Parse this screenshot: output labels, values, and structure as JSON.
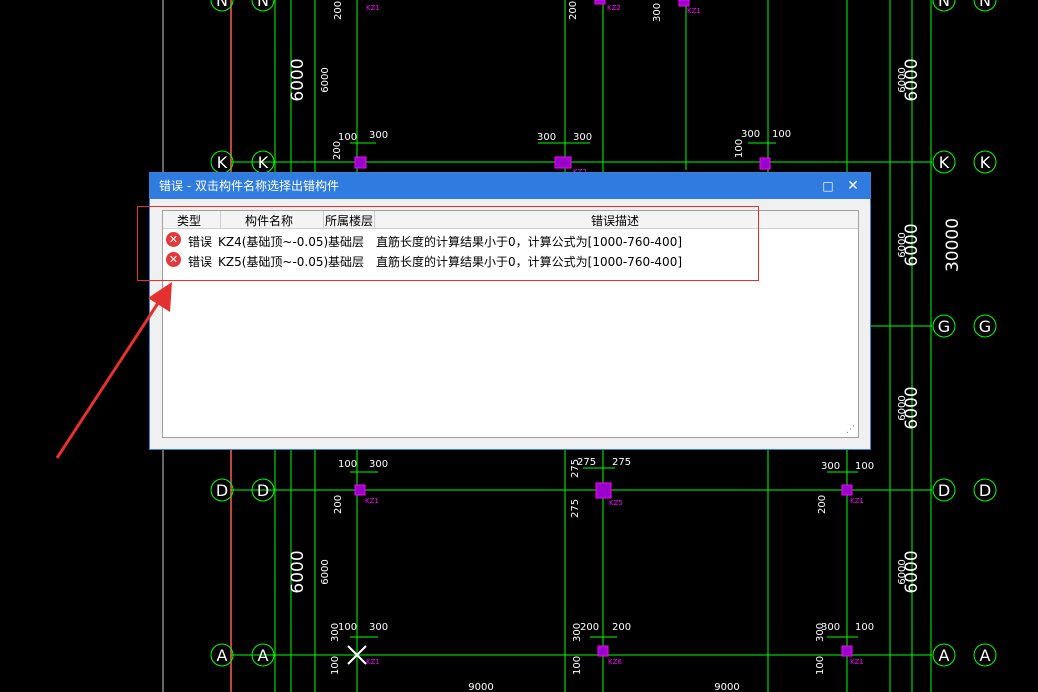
{
  "dialog": {
    "title": "错误 - 双击构件名称选择出错构件",
    "maximize_glyph": "□",
    "close_glyph": "✕",
    "columns": {
      "type": "类型",
      "name": "构件名称",
      "floor": "所属楼层",
      "description": "错误描述"
    },
    "rows": [
      {
        "type": "错误",
        "name": "KZ4(基础顶~-0.05)",
        "floor": "基础层",
        "description": "直筋长度的计算结果小于0，计算公式为[1000-760-400]"
      },
      {
        "type": "错误",
        "name": "KZ5(基础顶~-0.05)",
        "floor": "基础层",
        "description": "直筋长度的计算结果小于0，计算公式为[1000-760-400]"
      }
    ],
    "error_icon_glyph": "✕"
  },
  "drawing": {
    "axis_labels": [
      "N",
      "K",
      "G",
      "D",
      "A"
    ],
    "dims": [
      "6000",
      "6000",
      "6000",
      "6000",
      "6000",
      "6000",
      "6000",
      "30000",
      "9000",
      "9000"
    ],
    "small_dims": [
      "100",
      "200",
      "275",
      "300"
    ],
    "column_labels": [
      "KZ1",
      "KZ2",
      "KZ3",
      "KZ5",
      "KZ6"
    ],
    "colors": {
      "grid": "#00ff00",
      "column": "#ff00ff",
      "column_fill": "#9900cc",
      "axis_circle": "#00ff00",
      "error": "#e5383b",
      "annotation": "#e53030",
      "titlebar": "#2f7be0"
    }
  }
}
